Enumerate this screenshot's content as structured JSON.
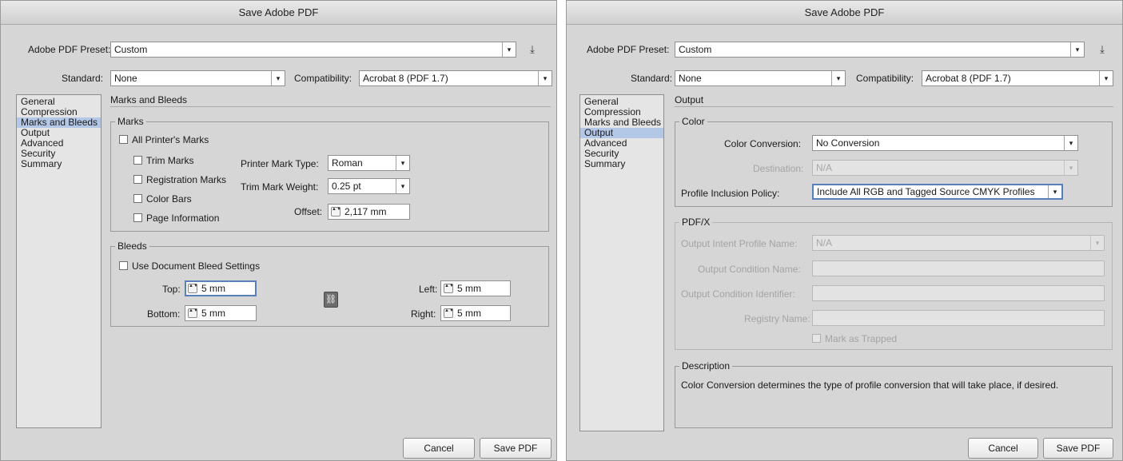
{
  "dialog1": {
    "title": "Save Adobe PDF",
    "preset_label": "Adobe PDF Preset:",
    "preset_value": "Custom",
    "standard_label": "Standard:",
    "standard_value": "None",
    "compat_label": "Compatibility:",
    "compat_value": "Acrobat 8 (PDF 1.7)",
    "sidebar": [
      "General",
      "Compression",
      "Marks and Bleeds",
      "Output",
      "Advanced",
      "Security",
      "Summary"
    ],
    "section_title": "Marks and Bleeds",
    "marks_group": "Marks",
    "all_printers_marks": "All Printer's Marks",
    "trim_marks": "Trim Marks",
    "registration_marks": "Registration Marks",
    "color_bars": "Color Bars",
    "page_information": "Page Information",
    "printer_mark_type_label": "Printer Mark Type:",
    "printer_mark_type_value": "Roman",
    "trim_mark_weight_label": "Trim Mark Weight:",
    "trim_mark_weight_value": "0.25 pt",
    "offset_label": "Offset:",
    "offset_value": "2,117 mm",
    "bleeds_group": "Bleeds",
    "use_doc_bleed": "Use Document Bleed Settings",
    "top_label": "Top:",
    "top_value": "5 mm",
    "bottom_label": "Bottom:",
    "bottom_value": "5 mm",
    "left_label": "Left:",
    "left_value": "5 mm",
    "right_label": "Right:",
    "right_value": "5 mm",
    "cancel": "Cancel",
    "save": "Save PDF"
  },
  "dialog2": {
    "title": "Save Adobe PDF",
    "preset_label": "Adobe PDF Preset:",
    "preset_value": "Custom",
    "standard_label": "Standard:",
    "standard_value": "None",
    "compat_label": "Compatibility:",
    "compat_value": "Acrobat 8 (PDF 1.7)",
    "sidebar": [
      "General",
      "Compression",
      "Marks and Bleeds",
      "Output",
      "Advanced",
      "Security",
      "Summary"
    ],
    "section_title": "Output",
    "color_group": "Color",
    "color_conversion_label": "Color Conversion:",
    "color_conversion_value": "No Conversion",
    "destination_label": "Destination:",
    "destination_value": "N/A",
    "profile_policy_label": "Profile Inclusion Policy:",
    "profile_policy_value": "Include All RGB and Tagged Source CMYK Profiles",
    "pdfx_group": "PDF/X",
    "output_intent_label": "Output Intent Profile Name:",
    "output_intent_value": "N/A",
    "output_condition_name_label": "Output Condition Name:",
    "output_condition_id_label": "Output Condition Identifier:",
    "registry_name_label": "Registry Name:",
    "mark_as_trapped": "Mark as Trapped",
    "description_group": "Description",
    "description_text": "Color Conversion determines the type of profile conversion that will take place, if desired.",
    "cancel": "Cancel",
    "save": "Save PDF"
  },
  "icons": {
    "dropdown_arrow": "▾",
    "spin_arrows": "▲▼",
    "save_preset": "⤓",
    "chain_link": "⛓"
  }
}
